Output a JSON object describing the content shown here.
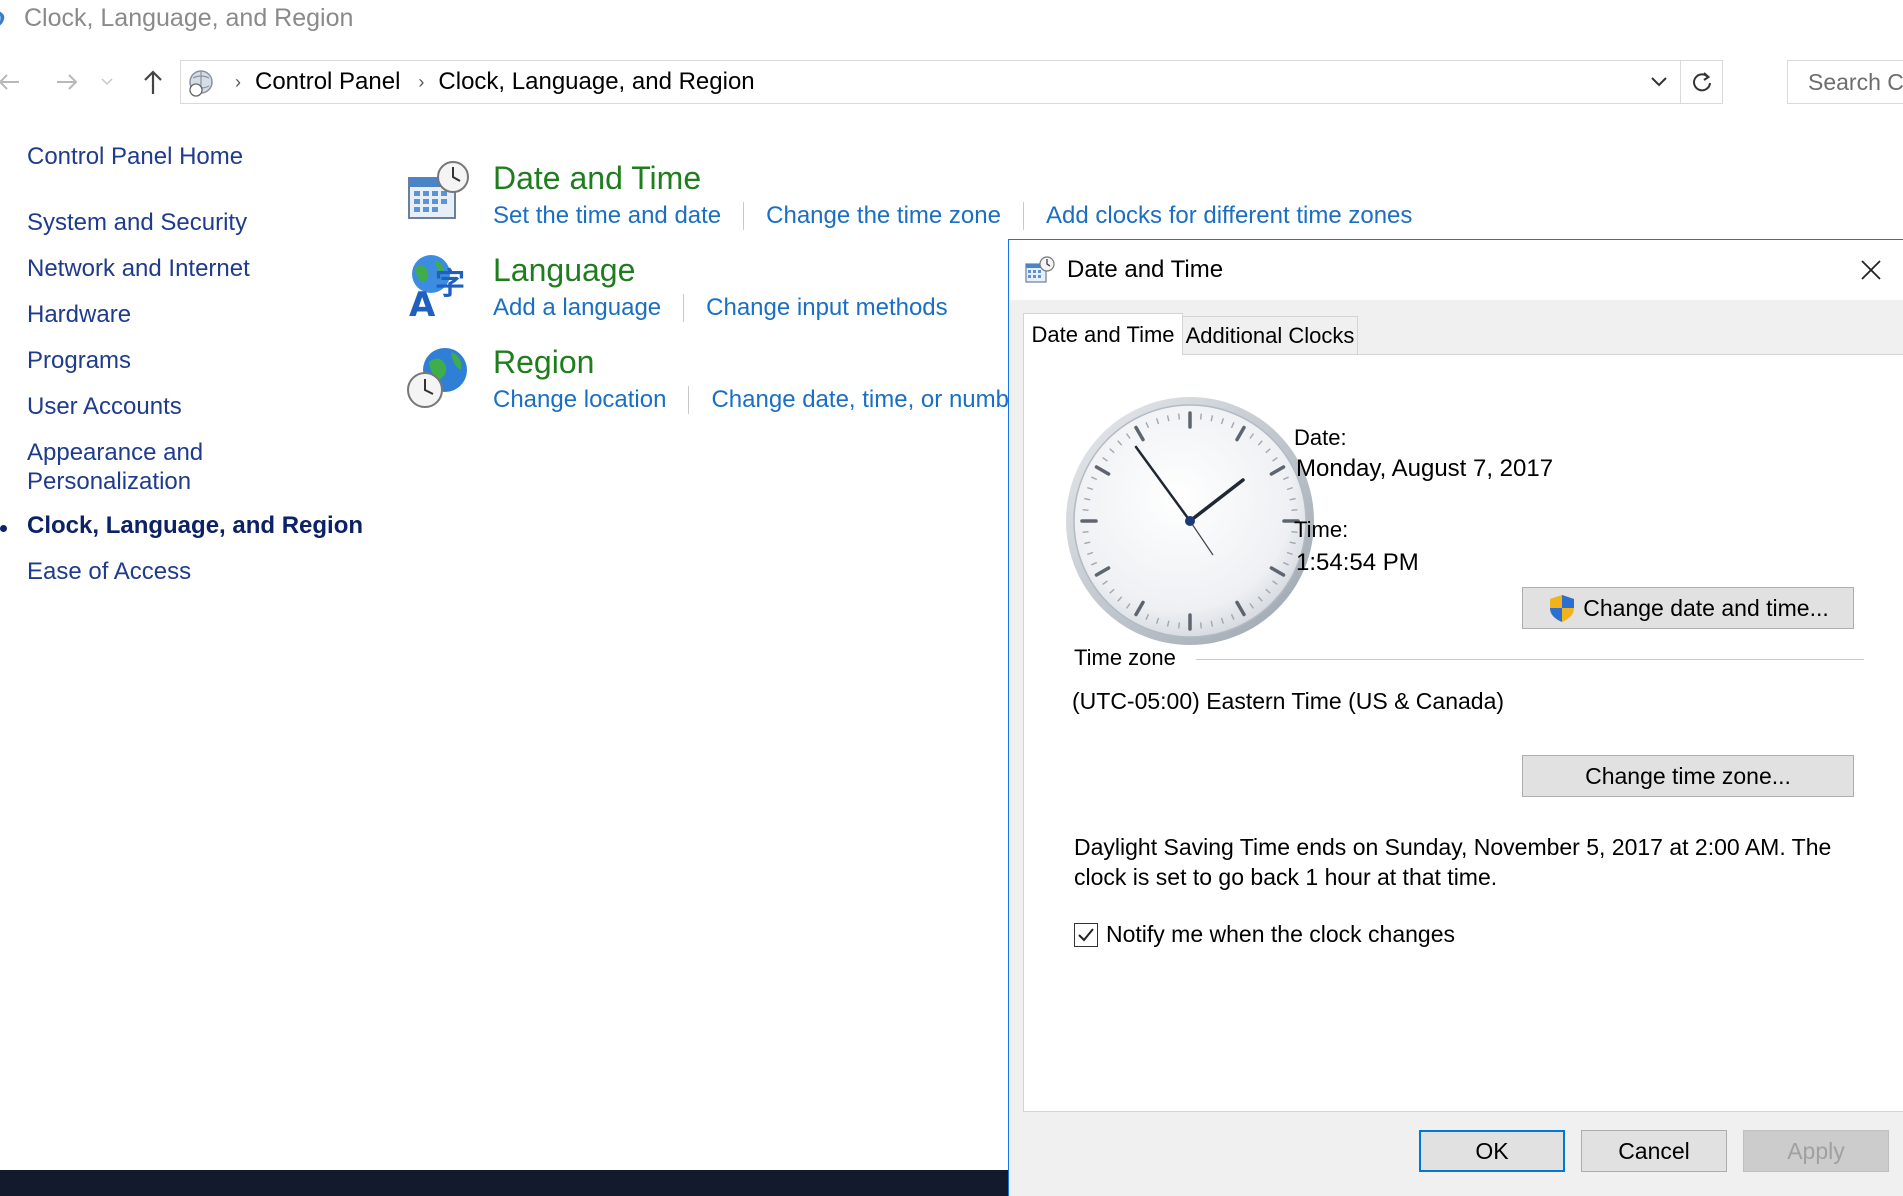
{
  "window": {
    "title": "Clock, Language, and Region"
  },
  "address_bar": {
    "crumbs": [
      "Control Panel",
      "Clock, Language, and Region"
    ],
    "search_placeholder": "Search Co"
  },
  "left_nav": {
    "items": [
      "Control Panel Home",
      "System and Security",
      "Network and Internet",
      "Hardware",
      "Programs",
      "User Accounts",
      "Appearance and",
      "Personalization",
      "Clock, Language, and Region",
      "Ease of Access"
    ]
  },
  "categories": [
    {
      "title": "Date and Time",
      "icon": "calendar-clock-icon",
      "links": [
        "Set the time and date",
        "Change the time zone",
        "Add clocks for different time zones"
      ]
    },
    {
      "title": "Language",
      "icon": "globe-language-icon",
      "links": [
        "Add a language",
        "Change input methods"
      ]
    },
    {
      "title": "Region",
      "icon": "globe-clock-icon",
      "links": [
        "Change location",
        "Change date, time, or numb"
      ]
    }
  ],
  "dialog": {
    "title": "Date and Time",
    "tabs": [
      "Date and Time",
      "Additional Clocks"
    ],
    "date_label": "Date:",
    "date_value": "Monday, August 7, 2017",
    "time_label": "Time:",
    "time_value": "1:54:54 PM",
    "change_datetime_button": "Change date and time...",
    "timezone_group": "Time zone",
    "timezone_value": "(UTC-05:00) Eastern Time (US & Canada)",
    "change_timezone_button": "Change time zone...",
    "dst_line1": "Daylight Saving Time ends on Sunday, November 5, 2017 at 2:00 AM. The",
    "dst_line2": "clock is set to go back 1 hour at that time.",
    "notify_checkbox": "Notify me when the clock changes",
    "notify_checked": true,
    "ok_button": "OK",
    "cancel_button": "Cancel",
    "apply_button": "Apply"
  },
  "colors": {
    "link": "#1a6fc4",
    "category_title": "#1e7e1e",
    "nav_text": "#1f3b8c",
    "accent": "#0078d7"
  }
}
